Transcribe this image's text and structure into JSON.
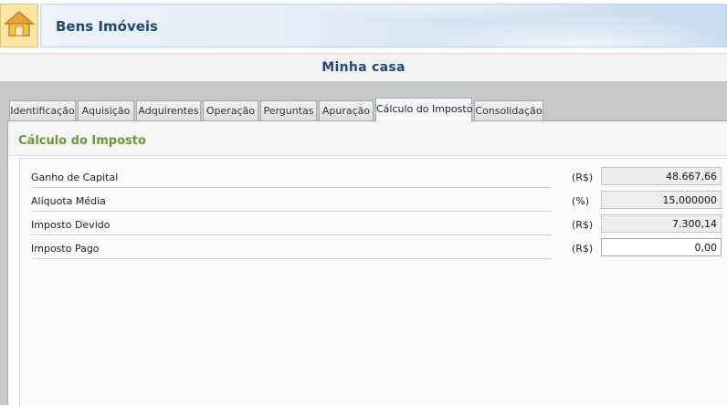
{
  "header": {
    "title": "Bens Imóveis",
    "home_icon": "home-icon"
  },
  "subtitle": "Minha casa",
  "tabs": [
    {
      "label": "Identificação"
    },
    {
      "label": "Aquisição"
    },
    {
      "label": "Adquirentes"
    },
    {
      "label": "Operação"
    },
    {
      "label": "Perguntas"
    },
    {
      "label": "Apuração"
    },
    {
      "label": "Cálculo do Imposto",
      "active": true
    },
    {
      "label": "Consolidação"
    }
  ],
  "section": {
    "title": "Cálculo do Imposto",
    "rows": [
      {
        "label": "Ganho de Capital",
        "unit": "(R$)",
        "value": "48.667,66"
      },
      {
        "label": "Alíquota Média",
        "unit": "(%)",
        "value": "15,000000"
      },
      {
        "label": "Imposto Devido",
        "unit": "(R$)",
        "value": "7.300,14"
      },
      {
        "label": "Imposto Pago",
        "unit": "(R$)",
        "value": "0,00"
      }
    ]
  },
  "colors": {
    "title": "#1a4a7a",
    "section_title": "#6b9a2f",
    "band": "#c8c8c8"
  }
}
